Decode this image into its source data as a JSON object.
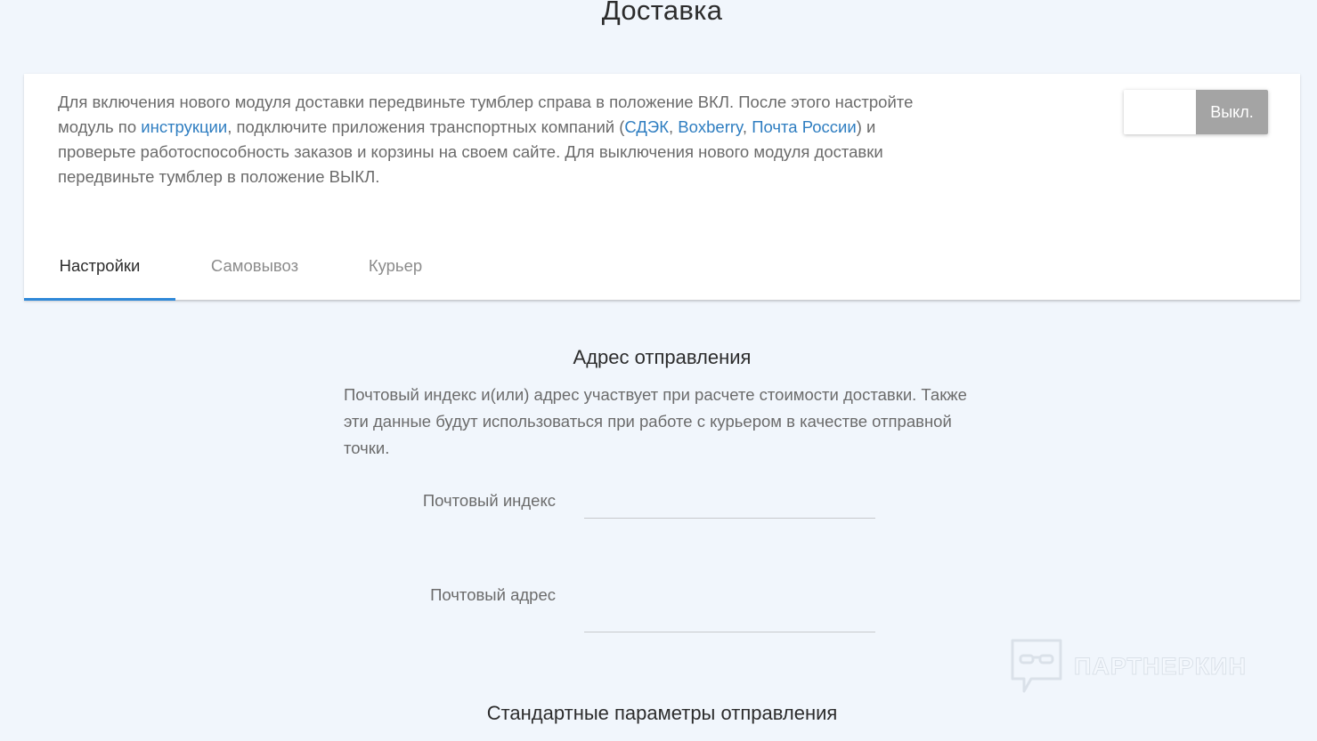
{
  "page": {
    "title": "Доставка"
  },
  "info": {
    "text_1": "Для включения нового модуля доставки передвиньте тумблер справа в положение ВКЛ. После этого настройте модуль по ",
    "link_instructions": "инструкции",
    "text_2": ", подключите приложения транспортных компаний (",
    "link_cdek": "СДЭК",
    "sep_1": ", ",
    "link_boxberry": "Boxberry",
    "sep_2": ", ",
    "link_russian_post": "Почта России",
    "text_3": ") и проверьте работоспособность заказов и корзины на своем сайте. Для выключения нового модуля доставки передвиньте тумблер в положение ВЫКЛ."
  },
  "toggle": {
    "label": "Выкл.",
    "state": "off"
  },
  "tabs": [
    {
      "label": "Настройки",
      "active": true
    },
    {
      "label": "Самовывоз",
      "active": false
    },
    {
      "label": "Курьер",
      "active": false
    }
  ],
  "address_section": {
    "title": "Адрес отправления",
    "description": "Почтовый индекс и(или) адрес участвует при расчете стоимости доставки. Также эти данные будут использоваться при работе с курьером в качестве отправной точки.",
    "fields": [
      {
        "label": "Почтовый индекс",
        "value": "",
        "placeholder": ""
      },
      {
        "label": "Почтовый адрес",
        "value": "",
        "placeholder": ""
      }
    ]
  },
  "params_section": {
    "title": "Стандартные параметры отправления"
  },
  "watermark": {
    "text": "ПАРТНЕРКИН",
    "icon": "chat-glasses-icon"
  },
  "colors": {
    "background": "#f1f6fc",
    "link": "#2f7ec1",
    "tab_active_underline": "#2f88d8",
    "toggle_off": "#a4a4a4"
  }
}
